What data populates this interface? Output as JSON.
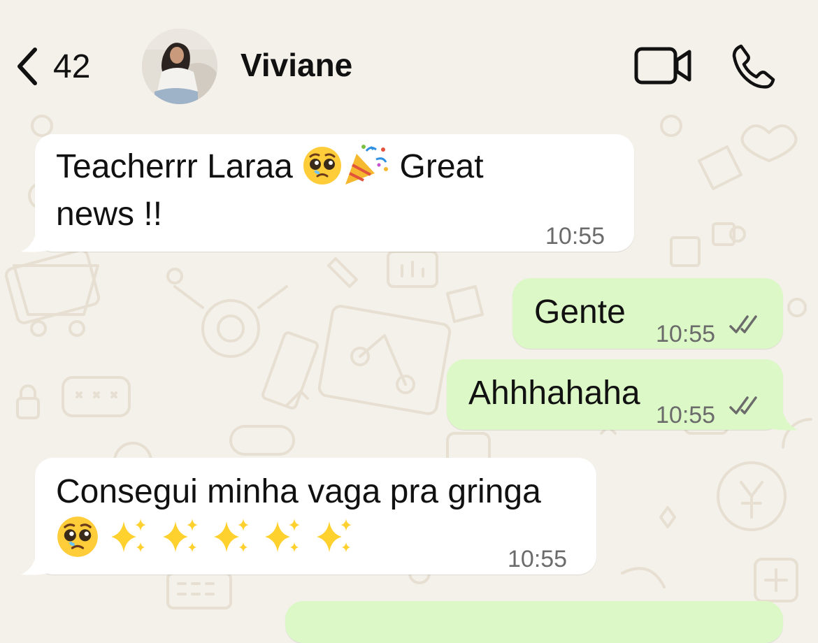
{
  "header": {
    "back_count": "42",
    "contact_name": "Viviane",
    "icons": [
      "chevron-left-icon",
      "video-call-icon",
      "phone-call-icon"
    ]
  },
  "messages": [
    {
      "direction": "incoming",
      "line1": "Teacherrr Laraa",
      "line1_tail": "Great",
      "line2": "news !!",
      "emojis": [
        "pleading-face",
        "party-popper"
      ],
      "time": "10:55"
    },
    {
      "direction": "outgoing",
      "text": "Gente",
      "time": "10:55",
      "status": "read"
    },
    {
      "direction": "outgoing",
      "text": "Ahhhahaha",
      "time": "10:55",
      "status": "read"
    },
    {
      "direction": "incoming",
      "line1": "Consegui minha vaga pra gringa",
      "emojis": [
        "pleading-face",
        "sparkles",
        "sparkles",
        "sparkles",
        "sparkles",
        "sparkles"
      ],
      "time": "10:55"
    }
  ],
  "colors": {
    "background": "#f4f1ea",
    "incoming_bubble": "#ffffff",
    "outgoing_bubble": "#dcf8c6",
    "timestamp": "#6b6b6b"
  }
}
